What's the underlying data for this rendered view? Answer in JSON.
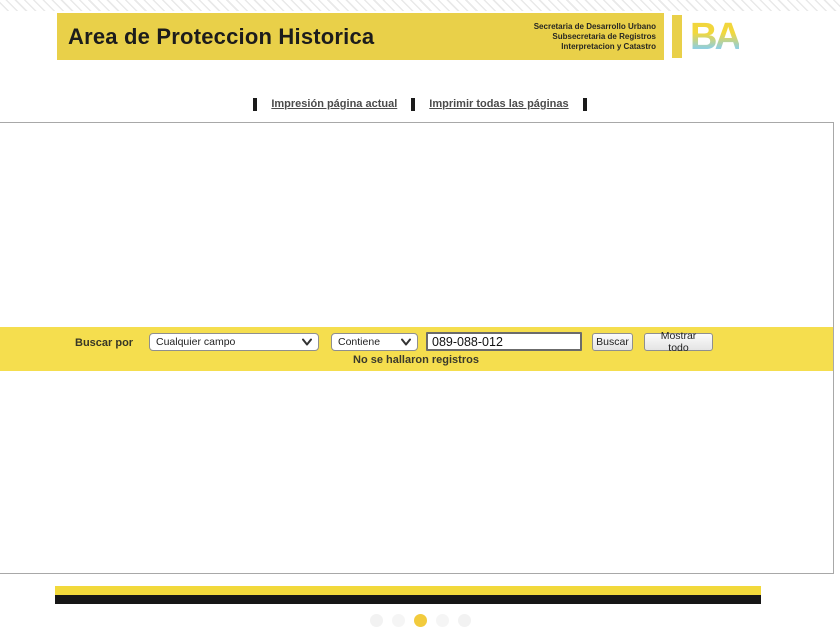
{
  "header": {
    "title": "Area de Proteccion Historica",
    "org_lines": [
      "Secretaria de Desarrollo Urbano",
      "Subsecretaria de Registros",
      "Interpretacion y Catastro"
    ],
    "logo_text": "BA"
  },
  "print_bar": {
    "link_print_current": "Impresión página actual",
    "link_print_all": "Imprimir todas las páginas"
  },
  "search": {
    "label": "Buscar por",
    "field_select_value": "Cualquier campo",
    "operator_select_value": "Contiene",
    "query_value": "089-088-012",
    "search_button_label": "Buscar",
    "show_all_button_label": "Mostrar todo",
    "no_results_message": "No se hallaron registros"
  },
  "pagination": {
    "dot_colors": [
      "#f2f2f2",
      "#f5f5f5",
      "#f2cb3d",
      "#f5f5f5",
      "#f2f2f2"
    ],
    "active_index": 2
  },
  "colors": {
    "header_yellow": "#e9d049",
    "search_band_yellow": "#f5de4e",
    "bottom_bar_yellow": "#f2d93b",
    "bottom_bar_black": "#161616",
    "active_dot_yellow": "#f2cb3d"
  }
}
